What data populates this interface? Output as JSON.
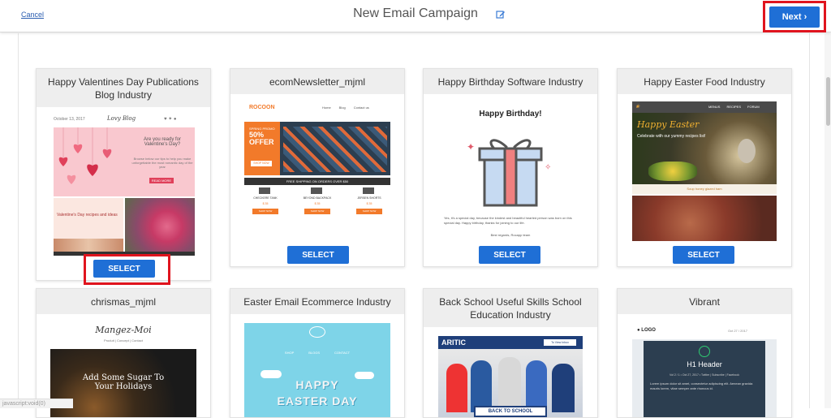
{
  "header": {
    "cancel_label": "Cancel",
    "title": "New Email Campaign",
    "next_label": "Next ›"
  },
  "colors": {
    "accent": "#1f6fd6",
    "highlight": "#e0141e",
    "card_header_bg": "#eeeeee"
  },
  "templates": [
    {
      "name": "Happy Valentines Day Publications Blog Industry",
      "select_label": "SELECT",
      "preview": {
        "date": "October 13, 2017",
        "blog_title": "Lovy Blog",
        "headline": "Are you ready for Valentine's Day?",
        "body": "Browse below our tips to help you make unforgettable the most romantic day of the year",
        "caption": "Valentine's Day recipes and ideas",
        "cta": "READ MORE"
      }
    },
    {
      "name": "ecomNewsletter_mjml",
      "select_label": "SELECT",
      "preview": {
        "logo": "ROCOON",
        "nav": [
          "Home",
          "Blog",
          "Contact us"
        ],
        "promo_pre": "SPRING PROMO",
        "promo_main": "50% OFFER",
        "shop_cta": "SHOP NOW",
        "shipping": "FREE SHIPPING ON ORDERS OVER $50",
        "products": [
          "CHECKERE TANK",
          "BEYOND BACKPACK",
          "JERSEN SHORTS"
        ],
        "prices": [
          "$ 35",
          "$ 35",
          "$ 35"
        ],
        "buy": "SHOP NOW"
      }
    },
    {
      "name": "Happy Birthday Software Industry",
      "select_label": "SELECT",
      "preview": {
        "heading": "Happy Birthday!",
        "body": "Yes, it's a special day, because the kindest and beautiful hearted person was born on this special day. Happy birthday, thanks for joining to our life.",
        "sign": "Best regards, Rocapp team"
      }
    },
    {
      "name": "Happy Easter Food Industry",
      "select_label": "SELECT",
      "preview": {
        "nav": [
          "MENUS",
          "RECIPES",
          "FORUM"
        ],
        "heading": "Happy Easter",
        "sub": "Celebrate with our yummy recipes list!",
        "caption": "Soup honey glazed ham"
      }
    },
    {
      "name": "chrismas_mjml",
      "preview": {
        "logo": "Mangez-Moi",
        "nav": "Produit | Concept | Contact",
        "headline": "Add Some Sugar To Your Holidays"
      }
    },
    {
      "name": "Easter Email Ecommerce Industry",
      "preview": {
        "nav": [
          "SHOP",
          "BLOGS",
          "CONTACT"
        ],
        "headline_1": "HAPPY",
        "headline_2": "EASTER DAY"
      }
    },
    {
      "name": "Back School Useful Skills School Education Industry",
      "preview": {
        "logo": "ARITIC",
        "view_link": "To View Inbox",
        "banner": "BACK TO SCHOOL"
      }
    },
    {
      "name": "Vibrant",
      "preview": {
        "logo": "LOGO",
        "date_range": "Oct 27 / 2017",
        "heading": "H1 Header",
        "meta": "Vol 2 / 1 • Oct 27, 2017 • Twitter | Subscribe | Facebook",
        "body": "Lorem ipsum dolor sit amet, consectetur adipiscing elit. Aenean gravida mauris lorem, vitae semper ante rhoncus id."
      }
    }
  ],
  "status_bar": "javascript:void(0)"
}
